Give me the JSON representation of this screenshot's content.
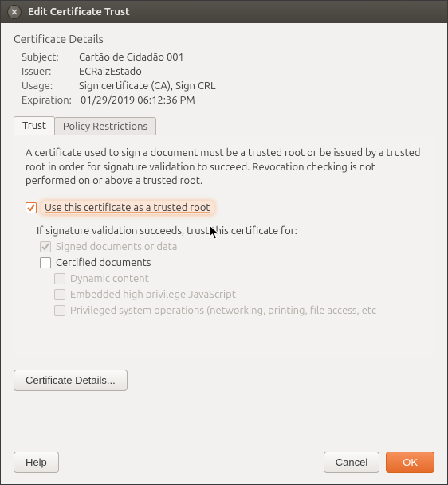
{
  "window": {
    "title": "Edit Certificate Trust"
  },
  "details": {
    "heading": "Certificate Details",
    "rows": {
      "subject": {
        "label": "Subject:",
        "value": "Cartão de Cidadão 001"
      },
      "issuer": {
        "label": "Issuer:",
        "value": "ECRaizEstado"
      },
      "usage": {
        "label": "Usage:",
        "value": "Sign certificate (CA), Sign CRL"
      },
      "expiration": {
        "label": "Expiration:",
        "value": "01/29/2019 06:12:36 PM"
      }
    }
  },
  "tabs": {
    "trust": {
      "label": "Trust"
    },
    "policy": {
      "label": "Policy Restrictions"
    }
  },
  "panel": {
    "description": "A certificate used to sign a document must be a trusted root or be issued by a trusted root in order for signature validation to succeed. Revocation checking is not performed on or above a trusted root.",
    "trusted_root_label": "Use this certificate as a trusted root",
    "sub_heading": "If signature validation succeeds, trust this certificate for:",
    "items": {
      "signed_docs": "Signed documents or data",
      "certified": "Certified documents",
      "dynamic": "Dynamic content",
      "embedded_js": "Embedded high privilege JavaScript",
      "privileged": "Privileged system operations (networking, printing, file access, etc"
    }
  },
  "buttons": {
    "cert_details": "Certificate Details...",
    "help": "Help",
    "cancel": "Cancel",
    "ok": "OK"
  }
}
